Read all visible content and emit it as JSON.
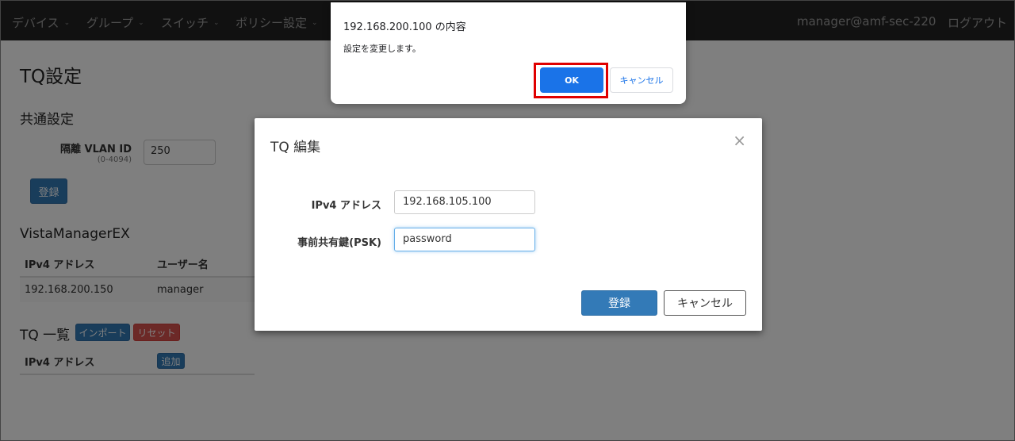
{
  "navbar": {
    "menu": [
      {
        "label": "デバイス"
      },
      {
        "label": "グループ"
      },
      {
        "label": "スイッチ"
      },
      {
        "label": "ポリシー設定"
      }
    ],
    "user": "manager@amf-sec-220",
    "logout": "ログアウト"
  },
  "page": {
    "title": "TQ設定",
    "common": {
      "heading": "共通設定",
      "vlan_label": "隔離 VLAN ID",
      "vlan_range": "(0-4094)",
      "vlan_value": "250",
      "register_button": "登録"
    },
    "vme": {
      "heading": "VistaManagerEX",
      "columns": [
        "IPv4 アドレス",
        "ユーザー名"
      ],
      "rows": [
        [
          "192.168.200.150",
          "manager"
        ]
      ]
    },
    "tq_list": {
      "heading": "TQ 一覧",
      "import_button": "インポート",
      "reset_button": "リセット",
      "column": "IPv4 アドレス",
      "add_button": "追加"
    }
  },
  "modal": {
    "title": "TQ 編集",
    "ipv4_label": "IPv4 アドレス",
    "ipv4_value": "192.168.105.100",
    "psk_label": "事前共有鍵(PSK)",
    "psk_value": "password",
    "submit_button": "登録",
    "cancel_button": "キャンセル"
  },
  "dialog": {
    "title": "192.168.200.100 の内容",
    "message": "設定を変更します。",
    "ok_button": "OK",
    "cancel_button": "キャンセル"
  },
  "colors": {
    "navbar_bg": "#222222",
    "primary": "#337ab7",
    "danger": "#d9534f",
    "dialog_ok": "#1a73e8",
    "highlight": "#e00000"
  }
}
